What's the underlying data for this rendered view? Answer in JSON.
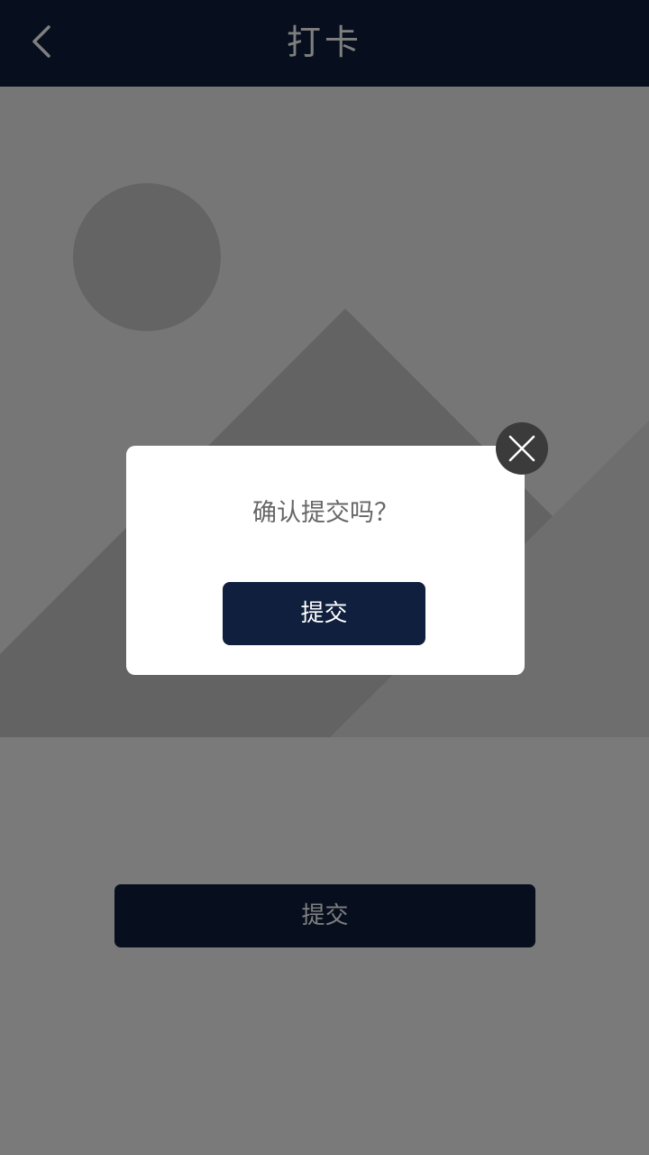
{
  "header": {
    "title": "打卡",
    "back_icon": "chevron-left-icon"
  },
  "image_placeholder": {
    "icon": "image-placeholder-icon"
  },
  "main": {
    "submit_label": "提交"
  },
  "dialog": {
    "message": "确认提交吗？",
    "submit_label": "提交",
    "close_icon": "close-icon"
  },
  "colors": {
    "navy": "#0f1f3d",
    "overlay": "rgba(0,0,0,0.5)",
    "dialog_bg": "#ffffff",
    "close_bg": "#3b3b3b",
    "message_text": "#666666"
  }
}
